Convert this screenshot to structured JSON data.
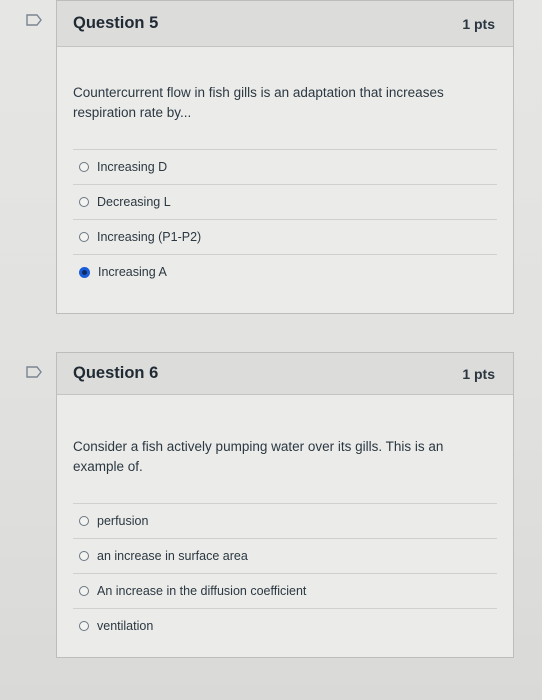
{
  "questions": [
    {
      "title": "Question 5",
      "points": "1 pts",
      "text": "Countercurrent flow in fish gills is an adaptation that increases respiration rate by...",
      "answers": [
        {
          "label": "Increasing D",
          "selected": false
        },
        {
          "label": "Decreasing L",
          "selected": false
        },
        {
          "label": "Increasing (P1-P2)",
          "selected": false
        },
        {
          "label": "Increasing A",
          "selected": true
        }
      ]
    },
    {
      "title": "Question 6",
      "points": "1 pts",
      "text": "Consider a fish actively pumping water over its gills. This is an example of.",
      "answers": [
        {
          "label": "perfusion",
          "selected": false
        },
        {
          "label": "an increase in surface area",
          "selected": false
        },
        {
          "label": "An increase in the diffusion coefficient",
          "selected": false
        },
        {
          "label": "ventilation",
          "selected": false
        }
      ]
    }
  ],
  "icons": {
    "flag": "flag-question-icon",
    "radio": "radio-button-icon"
  },
  "colors": {
    "selected_radio": "#1a5dd8",
    "header_bg": "#dcdcdb",
    "card_bg": "#ebebea"
  }
}
